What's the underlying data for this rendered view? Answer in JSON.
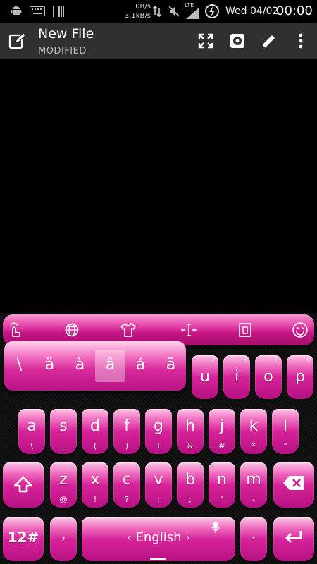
{
  "status_bar": {
    "net_speed_up": "0B/s",
    "net_speed_down": "3.1kB/s",
    "network": "LTE",
    "date": "Wed 04/02",
    "time": "00:00"
  },
  "action_bar": {
    "title": "New File",
    "subtitle": "MODIFIED"
  },
  "keyboard": {
    "accent_popup": [
      "\\",
      "ä",
      "à",
      "â",
      "á",
      "ā"
    ],
    "row1": [
      {
        "main": "u",
        "hint": "7"
      },
      {
        "main": "i",
        "hint": "8"
      },
      {
        "main": "o",
        "hint": "9"
      },
      {
        "main": "p",
        "hint": "0"
      }
    ],
    "row2": [
      {
        "main": "a",
        "sub": "\\"
      },
      {
        "main": "s",
        "sub": "_"
      },
      {
        "main": "d",
        "sub": "("
      },
      {
        "main": "f",
        "sub": ")"
      },
      {
        "main": "g",
        "sub": "+"
      },
      {
        "main": "h",
        "sub": "&"
      },
      {
        "main": "j",
        "sub": "#"
      },
      {
        "main": "k",
        "sub": "*"
      },
      {
        "main": "l",
        "sub": "\""
      }
    ],
    "row3": [
      {
        "main": "z",
        "sub": "@"
      },
      {
        "main": "x",
        "sub": "!"
      },
      {
        "main": "c",
        "sub": "?"
      },
      {
        "main": "v",
        "sub": ":"
      },
      {
        "main": "b",
        "sub": ";"
      },
      {
        "main": "n",
        "sub": "'"
      },
      {
        "main": "m",
        "sub": "-"
      }
    ],
    "symbols_label": "12#",
    "comma_label": ",",
    "space_label": "‹  English  ›",
    "period_label": "."
  },
  "colors": {
    "key_pink": "#d8239a",
    "action_bar": "#303030",
    "background": "#000000"
  }
}
